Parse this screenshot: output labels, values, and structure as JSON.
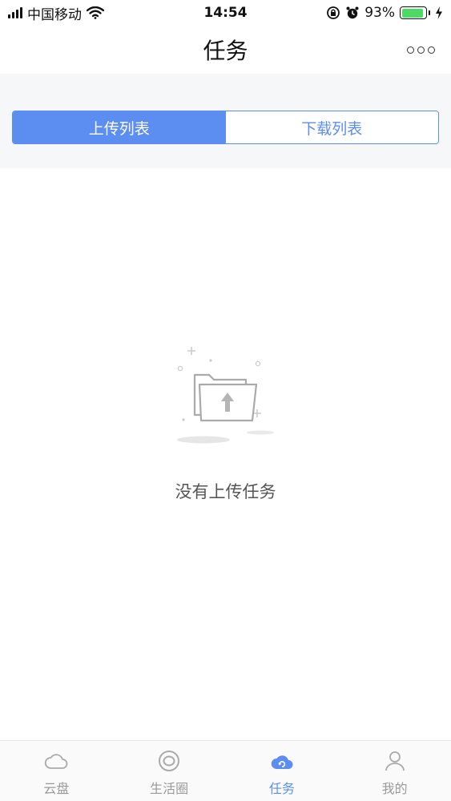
{
  "status_bar": {
    "carrier": "中国移动",
    "time": "14:54",
    "battery_percent": "93%",
    "battery_level": 0.93
  },
  "nav": {
    "title": "任务"
  },
  "segment": {
    "tabs": [
      {
        "label": "上传列表",
        "active": true
      },
      {
        "label": "下载列表",
        "active": false
      }
    ]
  },
  "empty_state": {
    "message": "没有上传任务"
  },
  "tab_bar": {
    "items": [
      {
        "label": "云盘",
        "icon": "cloud-icon",
        "active": false
      },
      {
        "label": "生活圈",
        "icon": "circle-icon",
        "active": false
      },
      {
        "label": "任务",
        "icon": "task-cloud-icon",
        "active": true
      },
      {
        "label": "我的",
        "icon": "person-icon",
        "active": false
      }
    ]
  },
  "colors": {
    "accent": "#5b8ef0",
    "inactive": "#999999",
    "battery": "#4cd964"
  }
}
